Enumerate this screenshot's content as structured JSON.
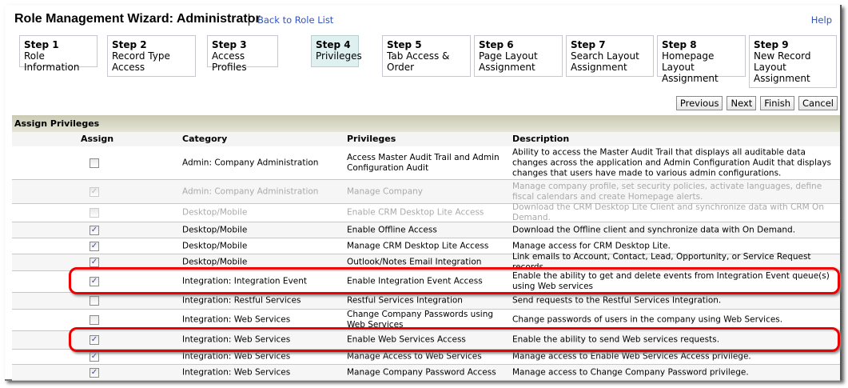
{
  "header": {
    "title": "Role Management Wizard: Administrator",
    "back_link": "Back to Role List",
    "help": "Help"
  },
  "steps": [
    {
      "num": "Step 1",
      "label": "Role Information"
    },
    {
      "num": "Step 2",
      "label": "Record Type Access"
    },
    {
      "num": "Step 3",
      "label": "Access Profiles"
    },
    {
      "num": "Step 4",
      "label": "Privileges"
    },
    {
      "num": "Step 5",
      "label": "Tab Access & Order"
    },
    {
      "num": "Step 6",
      "label": "Page Layout Assignment"
    },
    {
      "num": "Step 7",
      "label": "Search Layout Assignment"
    },
    {
      "num": "Step 8",
      "label": "Homepage Layout Assignment"
    },
    {
      "num": "Step 9",
      "label": "New Record Layout Assignment"
    }
  ],
  "buttons": {
    "previous": "Previous",
    "next": "Next",
    "finish": "Finish",
    "cancel": "Cancel"
  },
  "section_title": "Assign Privileges",
  "columns": {
    "assign": "Assign",
    "category": "Category",
    "privileges": "Privileges",
    "description": "Description"
  },
  "rows": [
    {
      "checked": false,
      "disabled": false,
      "category": "Admin: Company Administration",
      "privilege": "Access Master Audit Trail and Admin Configuration Audit",
      "description": "Ability to access the Master Audit Trail that displays all auditable data changes across the application and Admin Configuration Audit that displays changes that users have made to various admin configurations."
    },
    {
      "checked": true,
      "disabled": true,
      "category": "Admin: Company Administration",
      "privilege": "Manage Company",
      "description": "Manage company profile, set security policies, activate languages, define fiscal calendars and create Homepage alerts."
    },
    {
      "checked": false,
      "disabled": true,
      "category": "Desktop/Mobile",
      "privilege": "Enable CRM Desktop Lite Access",
      "description": "Download the CRM Desktop Lite Client and synchronize data with CRM On Demand."
    },
    {
      "checked": true,
      "disabled": false,
      "category": "Desktop/Mobile",
      "privilege": "Enable Offline Access",
      "description": "Download the Offline client and synchronize data with On Demand."
    },
    {
      "checked": true,
      "disabled": false,
      "category": "Desktop/Mobile",
      "privilege": "Manage CRM Desktop Lite Access",
      "description": "Manage access for CRM Desktop Lite."
    },
    {
      "checked": true,
      "disabled": false,
      "category": "Desktop/Mobile",
      "privilege": "Outlook/Notes Email Integration",
      "description": "Link emails to Account, Contact, Lead, Opportunity, or Service Request records."
    },
    {
      "checked": true,
      "disabled": false,
      "category": "Integration: Integration Event",
      "privilege": "Enable Integration Event Access",
      "description": "Enable the ability to get and delete events from Integration Event queue(s) using Web services"
    },
    {
      "checked": false,
      "disabled": false,
      "category": "Integration: Restful Services",
      "privilege": "Restful Services Integration",
      "description": "Send requests to the Restful Services Integration."
    },
    {
      "checked": false,
      "disabled": false,
      "category": "Integration: Web Services",
      "privilege": "Change Company Passwords using Web Services",
      "description": "Change passwords of users in the company using Web Services."
    },
    {
      "checked": true,
      "disabled": false,
      "category": "Integration: Web Services",
      "privilege": "Enable Web Services Access",
      "description": "Enable the ability to send Web services requests."
    },
    {
      "checked": true,
      "disabled": false,
      "category": "Integration: Web Services",
      "privilege": "Manage Access to Web Services",
      "description": "Manage access to Enable Web Services Access privilege."
    },
    {
      "checked": true,
      "disabled": false,
      "category": "Integration: Web Services",
      "privilege": "Manage Company Password Access",
      "description": "Manage access to Change Company Password privilege."
    }
  ],
  "colors": {
    "link": "#3355bb",
    "highlight": "#ee0000",
    "active_step": "#dff0f0"
  }
}
